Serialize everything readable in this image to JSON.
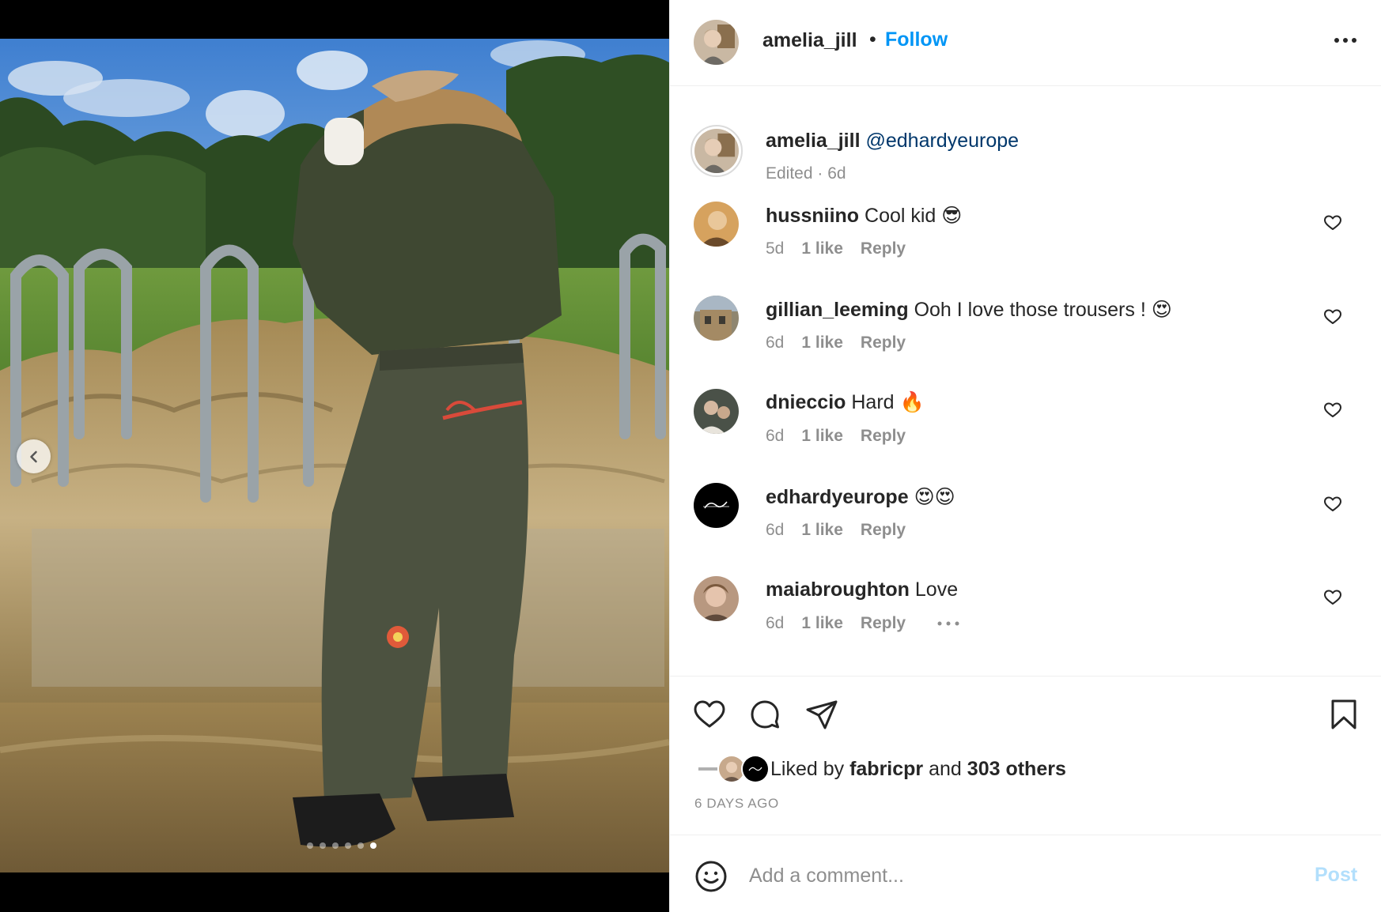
{
  "post": {
    "author": "amelia_jill",
    "separator": "•",
    "follow_label": "Follow",
    "more_icon": "more-horizontal-icon"
  },
  "caption": {
    "username": "amelia_jill",
    "mention": "@edhardyeurope",
    "meta": "Edited · 6d"
  },
  "comments": [
    {
      "username": "hussniino",
      "text": "Cool kid 😎",
      "age": "5d",
      "likes": "1 like",
      "reply": "Reply"
    },
    {
      "username": "gillian_leeming",
      "text": "Ooh I love those trousers ! 😍",
      "age": "6d",
      "likes": "1 like",
      "reply": "Reply"
    },
    {
      "username": "dnieccio",
      "text": "Hard 🔥",
      "age": "6d",
      "likes": "1 like",
      "reply": "Reply"
    },
    {
      "username": "edhardyeurope",
      "text": "😍😍",
      "age": "6d",
      "likes": "1 like",
      "reply": "Reply"
    },
    {
      "username": "maiabroughton",
      "text": "Love",
      "age": "6d",
      "likes": "1 like",
      "reply": "Reply"
    }
  ],
  "likes": {
    "prefix": "Liked by",
    "first_user": "fabricpr",
    "conjunction": "and",
    "others": "303 others"
  },
  "timestamp": "6 DAYS AGO",
  "composer": {
    "placeholder": "Add a comment...",
    "post_label": "Post"
  },
  "carousel": {
    "slide_count": 6,
    "active_index": 5
  },
  "colors": {
    "link_blue": "#0095f6",
    "mention_blue": "#00376b",
    "muted_text": "#8e8e8e",
    "disabled_post": "#b2dffc"
  }
}
